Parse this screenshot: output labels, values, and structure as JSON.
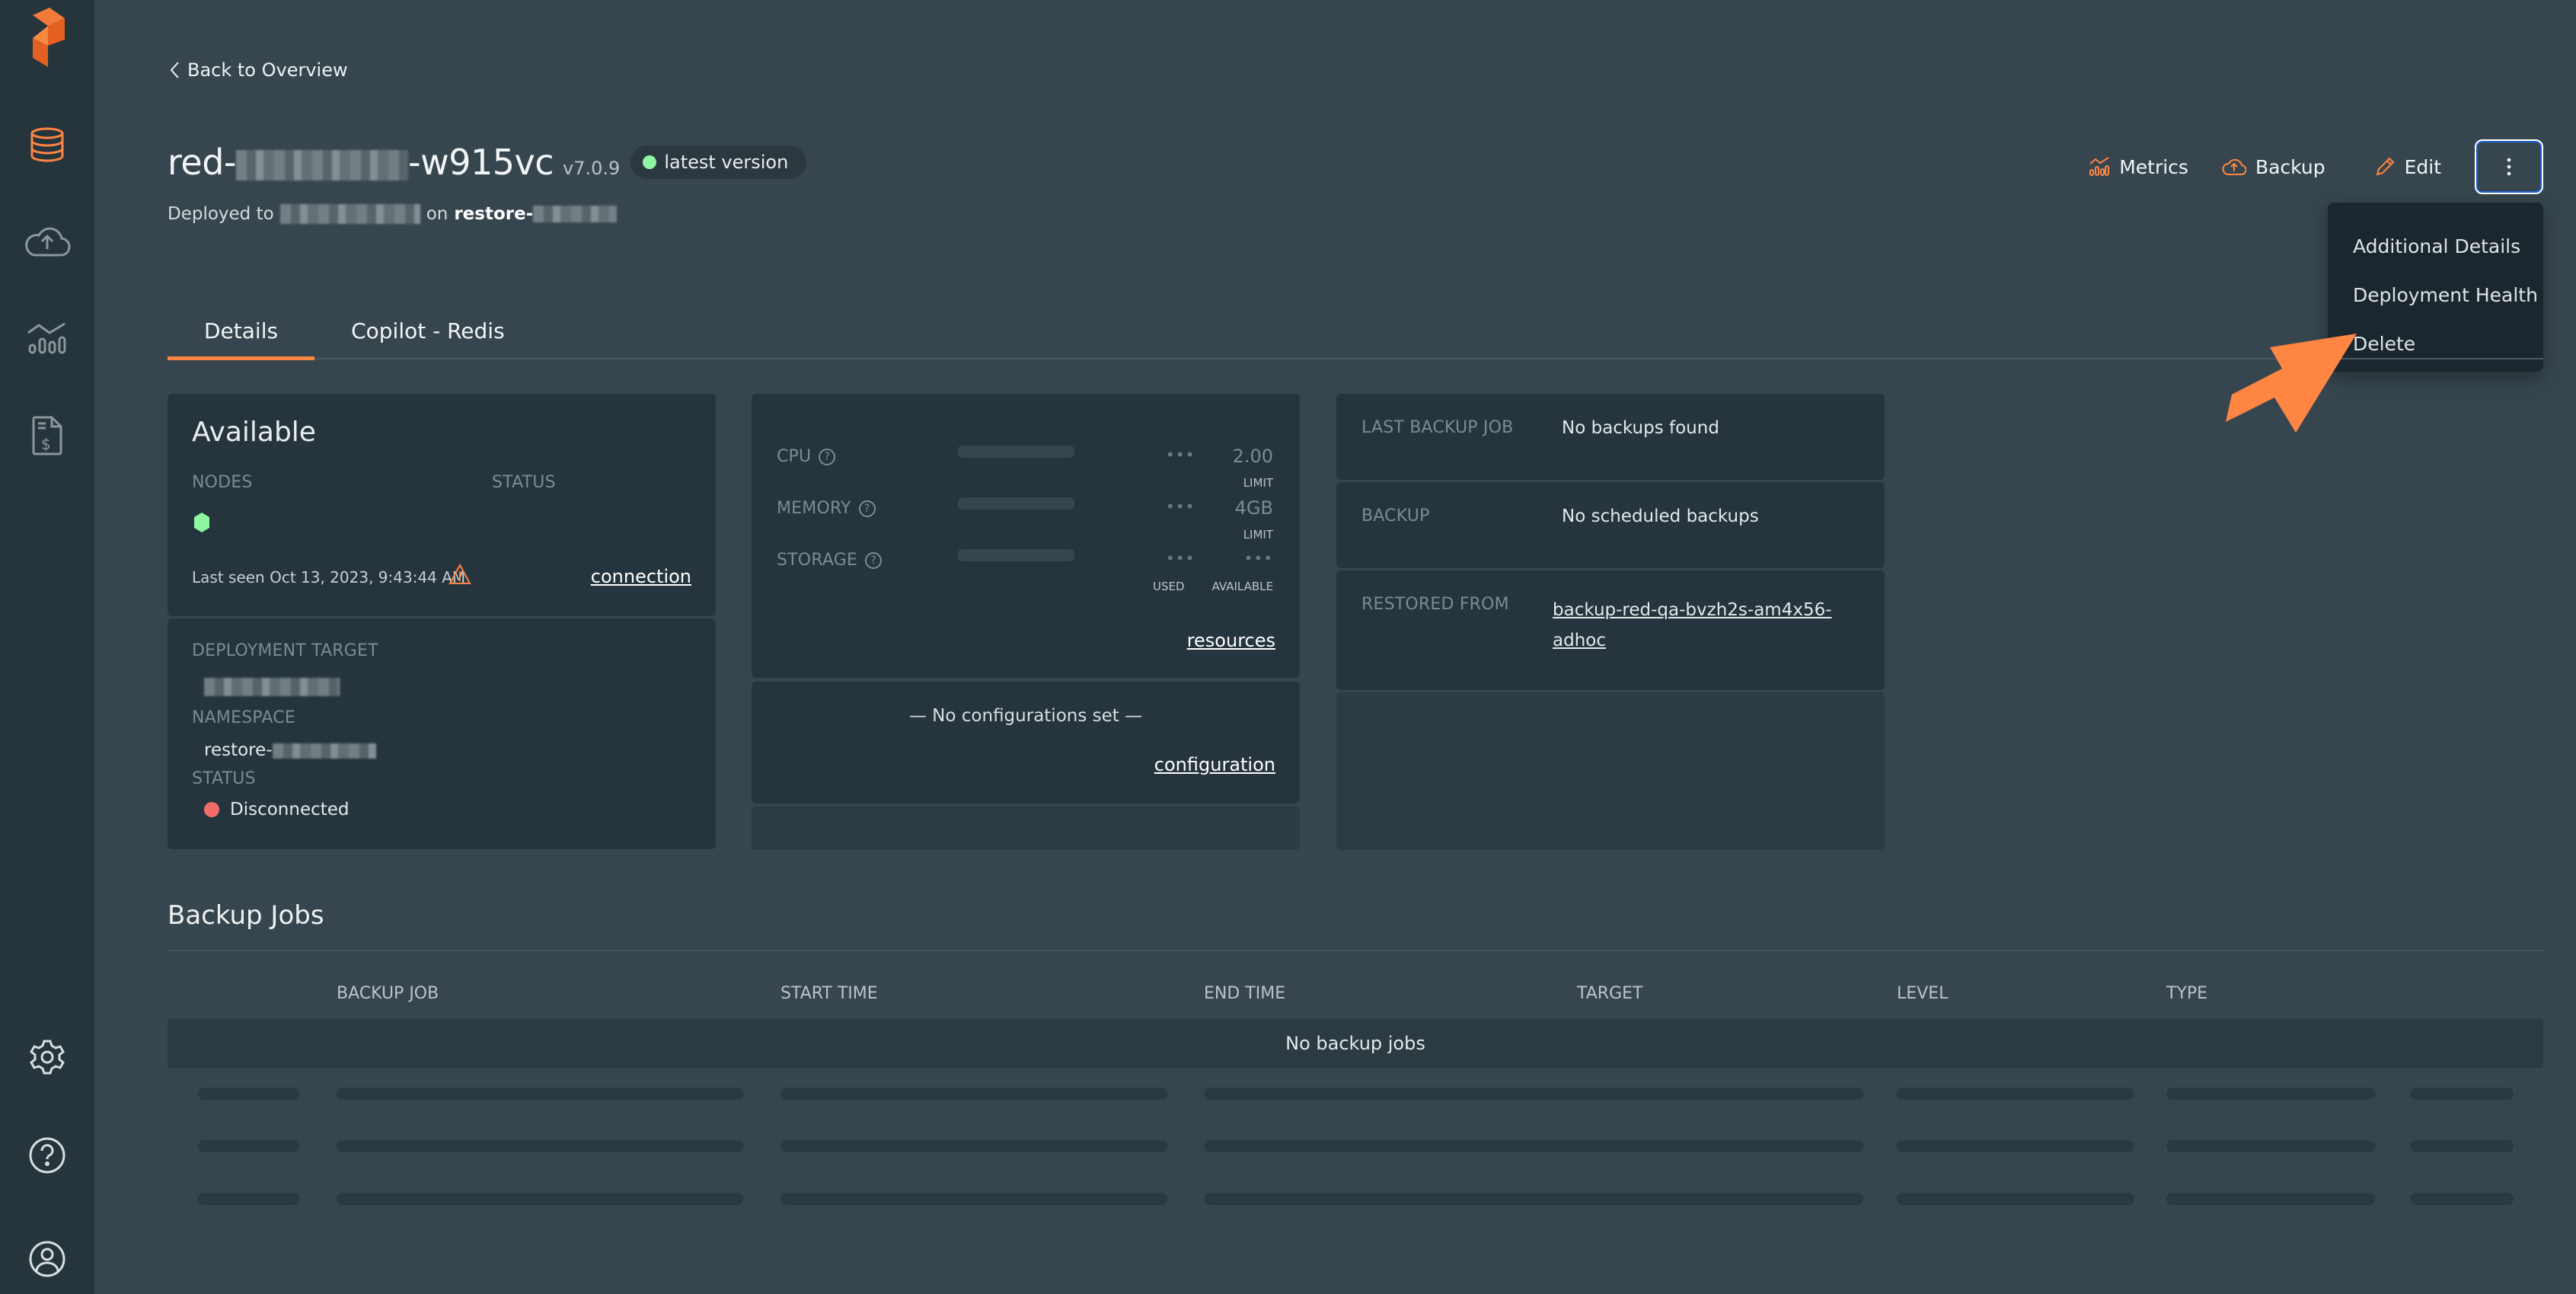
{
  "sidebar": {
    "logo": "brand-logo",
    "items": [
      {
        "icon": "database-icon",
        "active": true
      },
      {
        "icon": "cloud-upload-icon",
        "active": false
      },
      {
        "icon": "metrics-icon",
        "active": false
      },
      {
        "icon": "billing-icon",
        "active": false
      }
    ],
    "bottom_items": [
      {
        "icon": "gear-icon"
      },
      {
        "icon": "help-icon"
      },
      {
        "icon": "user-icon"
      }
    ]
  },
  "header": {
    "back_label": "Back to Overview",
    "title_prefix": "red-",
    "title_suffix": "-w915vc",
    "version": "v7.0.9",
    "badge_label": "latest version",
    "deployed_prefix": "Deployed to",
    "deployed_on": "on",
    "namespace_prefix": "restore-"
  },
  "actions": {
    "metrics_label": "Metrics",
    "backup_label": "Backup",
    "edit_label": "Edit",
    "more_icon": "kebab-icon"
  },
  "menu": {
    "items": [
      "Additional Details",
      "Deployment Health",
      "Delete"
    ]
  },
  "tabs": [
    {
      "label": "Details",
      "active": true
    },
    {
      "label": "Copilot - Redis",
      "active": false
    }
  ],
  "status_card": {
    "state": "Available",
    "nodes_label": "NODES",
    "status_label": "STATUS",
    "last_seen": "Last seen Oct 13, 2023, 9:43:44 AM",
    "connection_link": "connection",
    "deployment_target_label": "DEPLOYMENT TARGET",
    "namespace_label": "NAMESPACE",
    "namespace_value_prefix": "restore-",
    "target_status_label": "STATUS",
    "target_status_value": "Disconnected"
  },
  "resources_card": {
    "rows": [
      {
        "label": "CPU",
        "used": "•••",
        "limit": "2.00",
        "limit_caption": "LIMIT"
      },
      {
        "label": "MEMORY",
        "used": "•••",
        "limit": "4GB",
        "limit_caption": "LIMIT"
      },
      {
        "label": "STORAGE",
        "used": "•••",
        "limit": "•••"
      }
    ],
    "used_caption": "USED",
    "available_caption": "AVAILABLE",
    "resources_link": "resources",
    "no_config": "— No configurations set —",
    "configuration_link": "configuration"
  },
  "backup_card": {
    "last_backup_label": "LAST BACKUP JOB",
    "last_backup_value": "No backups found",
    "backup_label": "BACKUP",
    "backup_value": "No scheduled backups",
    "restored_label": "RESTORED FROM",
    "restored_value": "backup-red-qa-bvzh2s-am4x56-adhoc",
    "restored_line1": "backup-red-qa-bvzh2s-am4x56-",
    "restored_line2": "adhoc"
  },
  "backup_jobs": {
    "title": "Backup Jobs",
    "columns": [
      "BACKUP JOB",
      "START TIME",
      "END TIME",
      "TARGET",
      "LEVEL",
      "TYPE"
    ],
    "empty_message": "No backup jobs"
  },
  "colors": {
    "accent": "#ff8543",
    "sidebar_bg": "#26343c",
    "page_bg": "#37464e",
    "card_bg": "#26353d",
    "success": "#8ef5a0",
    "error": "#f26c6c",
    "focus": "#1d63d6"
  }
}
